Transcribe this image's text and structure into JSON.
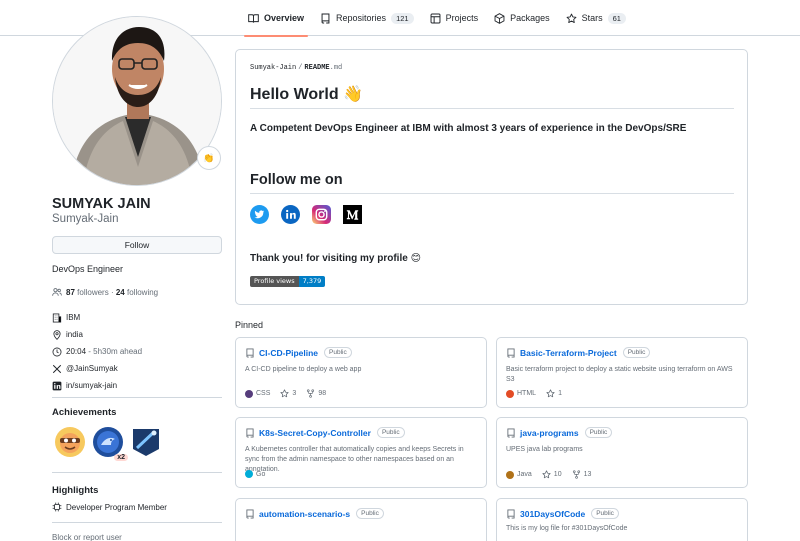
{
  "nav": {
    "tabs": [
      {
        "label": "Overview",
        "count": ""
      },
      {
        "label": "Repositories",
        "count": "121"
      },
      {
        "label": "Projects",
        "count": ""
      },
      {
        "label": "Packages",
        "count": ""
      },
      {
        "label": "Stars",
        "count": "61"
      }
    ]
  },
  "profile": {
    "fullname": "SUMYAK JAIN",
    "login": "Sumyak-Jain",
    "status_emoji": "👏",
    "follow_label": "Follow",
    "bio": "DevOps Engineer",
    "followers_count": "87",
    "followers_label": "followers",
    "separator": "·",
    "following_count": "24",
    "following_label": "following",
    "company": "IBM",
    "location": "india",
    "time": "20:04",
    "time_note": "- 5h30m ahead",
    "twitter": "@JainSumyak",
    "linkedin": "in/sumyak-jain"
  },
  "achievements": {
    "title": "Achievements",
    "multiplier": "x2"
  },
  "highlights": {
    "title": "Highlights",
    "item": "Developer Program Member"
  },
  "report_label": "Block or report user",
  "readme": {
    "owner": "Sumyak-Jain",
    "slash": "/",
    "file": "README",
    "ext": ".md",
    "heading": "Hello World 👋",
    "tagline": "A Competent DevOps Engineer at IBM with almost 3 years of experience in the DevOps/SRE",
    "follow_heading": "Follow me on",
    "thanks": "Thank you! for visiting my profile 😊",
    "views_label": "Profile views",
    "views_count": "7,379"
  },
  "pinned": {
    "title": "Pinned",
    "public_label": "Public",
    "cards": [
      {
        "name": "CI-CD-Pipeline",
        "desc": "A CI-CD pipeline to deploy a web app",
        "lang": "CSS",
        "color": "#563d7c",
        "stars": "3",
        "forks": "98"
      },
      {
        "name": "Basic-Terraform-Project",
        "desc": "Basic terraform project to deploy a static website using terraform on AWS S3",
        "lang": "HTML",
        "color": "#e34c26",
        "stars": "1",
        "forks": ""
      },
      {
        "name": "K8s-Secret-Copy-Controller",
        "desc": "A Kubernetes controller that automatically copies and keeps Secrets in sync from the admin namespace to other namespaces based on an annotation.",
        "lang": "Go",
        "color": "#00add8",
        "stars": "",
        "forks": ""
      },
      {
        "name": "java-programs",
        "desc": "UPES java lab programs",
        "lang": "Java",
        "color": "#b07219",
        "stars": "10",
        "forks": "13"
      },
      {
        "name": "automation-scenario-s",
        "desc": "",
        "lang": "",
        "color": "",
        "stars": "",
        "forks": ""
      },
      {
        "name": "301DaysOfCode",
        "desc": "This is my log file for #301DaysOfCode",
        "lang": "",
        "color": "",
        "stars": "",
        "forks": ""
      }
    ]
  }
}
